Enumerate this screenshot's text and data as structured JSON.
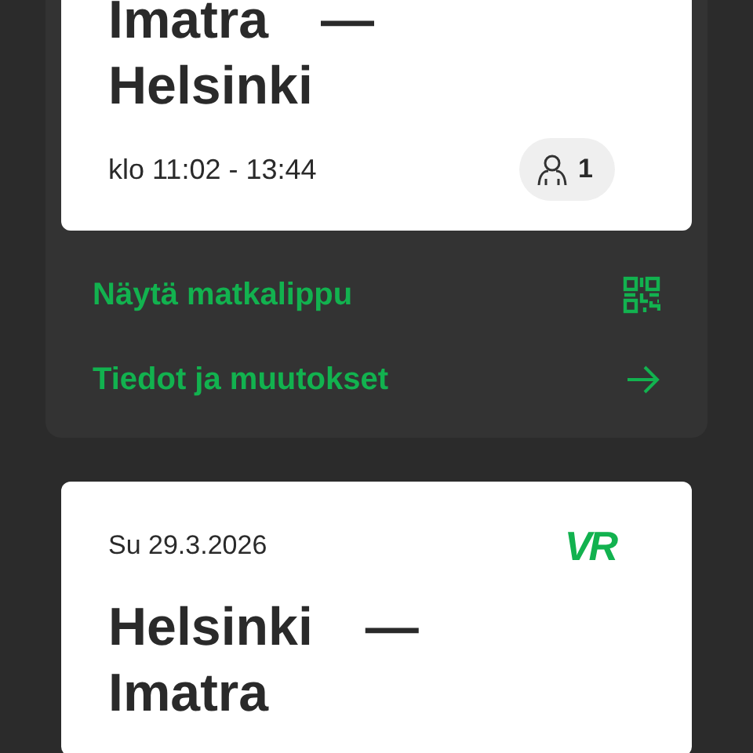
{
  "trips": [
    {
      "origin": "Imatra",
      "dash": "—",
      "destination": "Helsinki",
      "time": "klo 11:02 - 13:44",
      "passengers": "1",
      "actions": [
        {
          "label": "Näytä matkalippu",
          "kind": "qr"
        },
        {
          "label": "Tiedot ja muutokset",
          "kind": "arrow"
        }
      ]
    },
    {
      "date": "Su 29.3.2026",
      "logo": "VR",
      "origin": "Helsinki",
      "dash": "—",
      "destination": "Imatra"
    }
  ]
}
